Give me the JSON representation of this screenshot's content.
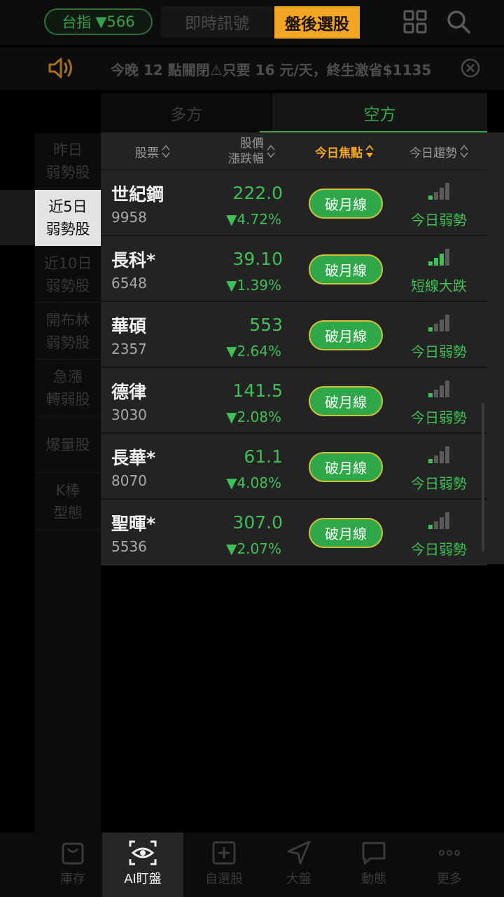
{
  "topbar": {
    "index_label": "台指",
    "index_change": "▼566",
    "tab_live": "即時訊號",
    "tab_after": "盤後選股"
  },
  "announcement": {
    "text": "今晚 12 點關閉⚠只要 16 元/天，終生激省$1135"
  },
  "side_tabs": {
    "long": "多方",
    "short": "空方"
  },
  "categories": [
    {
      "line1": "昨日",
      "line2": "弱勢股"
    },
    {
      "line1": "近5日",
      "line2": "弱勢股"
    },
    {
      "line1": "近10日",
      "line2": "弱勢股"
    },
    {
      "line1": "開布林",
      "line2": "弱勢股"
    },
    {
      "line1": "急漲",
      "line2": "轉弱股"
    },
    {
      "line1": "爆量股",
      "line2": ""
    },
    {
      "line1": "K棒",
      "line2": "型態"
    }
  ],
  "table": {
    "headers": {
      "stock": "股票",
      "price_line1": "股價",
      "price_line2": "漲跌幅",
      "focus": "今日焦點",
      "trend": "今日趨勢"
    },
    "rows": [
      {
        "name": "世紀鋼",
        "code": "9958",
        "price": "222.0",
        "change": "▼4.72%",
        "focus": "破月線",
        "trend": "今日弱勢",
        "trend_level": 1
      },
      {
        "name": "長科*",
        "code": "6548",
        "price": "39.10",
        "change": "▼1.39%",
        "focus": "破月線",
        "trend": "短線大跌",
        "trend_level": 3
      },
      {
        "name": "華碩",
        "code": "2357",
        "price": "553",
        "change": "▼2.64%",
        "focus": "破月線",
        "trend": "今日弱勢",
        "trend_level": 1
      },
      {
        "name": "德律",
        "code": "3030",
        "price": "141.5",
        "change": "▼2.08%",
        "focus": "破月線",
        "trend": "今日弱勢",
        "trend_level": 1
      },
      {
        "name": "長華*",
        "code": "8070",
        "price": "61.1",
        "change": "▼4.08%",
        "focus": "破月線",
        "trend": "今日弱勢",
        "trend_level": 1
      },
      {
        "name": "聖暉*",
        "code": "5536",
        "price": "307.0",
        "change": "▼2.07%",
        "focus": "破月線",
        "trend": "今日弱勢",
        "trend_level": 1
      }
    ]
  },
  "bottom_nav": [
    {
      "label": "庫存",
      "icon": "bag-icon"
    },
    {
      "label": "AI盯盤",
      "icon": "eye-scan-icon"
    },
    {
      "label": "自選股",
      "icon": "plus-square-icon"
    },
    {
      "label": "大盤",
      "icon": "navigation-arrow-icon"
    },
    {
      "label": "動態",
      "icon": "chat-bubble-icon"
    },
    {
      "label": "更多",
      "icon": "more-dots-icon"
    }
  ],
  "colors": {
    "accent_orange": "#f2a623",
    "down_green": "#3fbf55",
    "focus_button": "#2fa84a",
    "focus_border": "#cfc138"
  }
}
